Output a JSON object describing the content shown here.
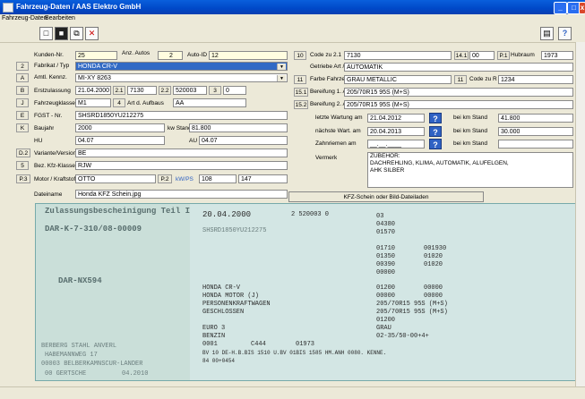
{
  "window": {
    "title": "Fahrzeug-Daten  /  AAS Elektro GmbH"
  },
  "menu": {
    "items": [
      "Fahrzeug-Daten",
      "Bearbeiten"
    ]
  },
  "left": {
    "kundennr_label": "Kunden-Nr.",
    "kundennr": "25",
    "anz_autos_label": "Anz. Autos",
    "anz_autos": "2",
    "auto_id_label": "Auto-ID",
    "auto_id": "12",
    "num2": "2",
    "fabrikat_label": "Fabrikat / Typ",
    "fabrikat": "HONDA CR-V",
    "numA": "A",
    "amtl_label": "Amtl. Kennz.",
    "amtl": "MI-XY 8263",
    "numB": "B",
    "erstzul_label": "Erstzulassung",
    "erstzul": "21.04.2000",
    "n21": "2.1",
    "v21": "7130",
    "n22": "2.2",
    "v22": "520003",
    "n3": "3",
    "v3": "0",
    "numJ": "J",
    "fzklasse_label": "Fahrzeugklasse",
    "fzklasse": "M1",
    "n4": "4",
    "art_label": "Art d. Aufbaus",
    "art": "AA",
    "numE": "E",
    "fgst_label": "FGST - Nr.",
    "fgst": "SHSRD1850YU212275",
    "numK": "K",
    "baujahr_label": "Baujahr",
    "baujahr": "2000",
    "kw_label": "kw Stand",
    "kw": "81.800",
    "hu_label": "HU",
    "hu": "04.07",
    "au_label": "AU",
    "au": "04.07",
    "numD2": "D.2",
    "variante_label": "Variante/Version",
    "variante": "BE",
    "num5": "5",
    "bez_label": "Bez. Kfz-Klasse",
    "bez": "RJW",
    "numP3": "P.3",
    "motor_label": "Motor / Kraftstoff",
    "motor": "OTTO",
    "p2": "P.2",
    "kwps_label": "kW/PS",
    "kw_val": "108",
    "ps_val": "147",
    "datei_label": "Dateiname",
    "datei": "Honda KFZ Schein.jpg"
  },
  "right": {
    "n10": "10",
    "code_label": "Code zu 2.1",
    "code": "7130",
    "n141": "14.1",
    "v141": "00",
    "p1": "P.1",
    "hubraum_label": "Hubraum",
    "hubraum": "1973",
    "getriebe_label": "Getriebe Art / Kz.",
    "getriebe": "AUTOMATIK",
    "n11": "11",
    "farbe_label": "Farbe Fahrzeug",
    "farbe": "GRAU METALLIC",
    "n11b": "11",
    "code_a_label": "Code zu R",
    "code_a": "1234",
    "n151": "15.1",
    "bereifung_v_label": "Bereifung 1. Achse",
    "bereifung_v": "205/70R15 95S (M+S)",
    "n152": "15.2",
    "bereifung_h_label": "Bereifung 2. Achse",
    "bereifung_h": "205/70R15 95S (M+S)",
    "wartung_label": "letzte Wartung am",
    "wartung": "21.04.2012",
    "wartung_km_label": "bei km Stand",
    "wartung_km": "41.800",
    "naechste_label": "nächste Wart. am",
    "naechste": "20.04.2013",
    "naechste_km_label": "bei km Stand",
    "naechste_km": "30.000",
    "zahn_label": "Zahnriemen am",
    "zahn": "__.__.____",
    "zahn_km_label": "bei km Stand",
    "zahn_km": "",
    "vermerk_label": "Vermerk",
    "vermerk": "ZUBEHÖR:\nDACHREHLING, KLIMA, AUTOMATIK, ALUFELGEN,\nAHK SILBER",
    "kfz_button": "KFZ-Schein oder Bild-Dateiladen"
  },
  "scan": {
    "heading": "Zulassungsbescheinigung Teil I",
    "ident": "DAR-K-7-310/08-00009",
    "plate": "DAR-NX594",
    "date": "20.04.2000",
    "code": "2 520003 0",
    "fgst": "SHSRD1850YU212275",
    "model1": "HONDA CR-V",
    "model2": "HONDA MOTOR (J)",
    "model3": "PERSONENKRAFTWAGEN",
    "model4": "GESCHLOSSEN",
    "euro": "EURO 3",
    "fuel": "BENZIN",
    "r1": "0001",
    "r2": "C444",
    "r3": "01973",
    "notes": "BV 10 DE-H.B.BIS 1510 U.BV 01BIS 1585 HM.ANH 0080. KENNE.",
    "notes2": "84 00+0454",
    "owner1": "BERBERG STAHL ANVERL",
    "owner2": "HABEMANNWEG 17",
    "owner3": "00003 BELBERKAMNSCUR-LANDER",
    "place": "00 GERTSCHE",
    "stamp": "04.2010",
    "tyre1": "205/70R15 95S (M+S)",
    "tyre2": "205/70R15 95S (M+S)",
    "color": "GRAU",
    "misc": "02-35/50-00+4+",
    "right_col": [
      "03",
      "04380",
      "01570",
      "01710",
      "01350",
      "00390",
      "00000",
      "01200",
      "00000",
      "01200"
    ],
    "right_col2": [
      "001930",
      "01020",
      "01020",
      "00000",
      "00000"
    ]
  }
}
